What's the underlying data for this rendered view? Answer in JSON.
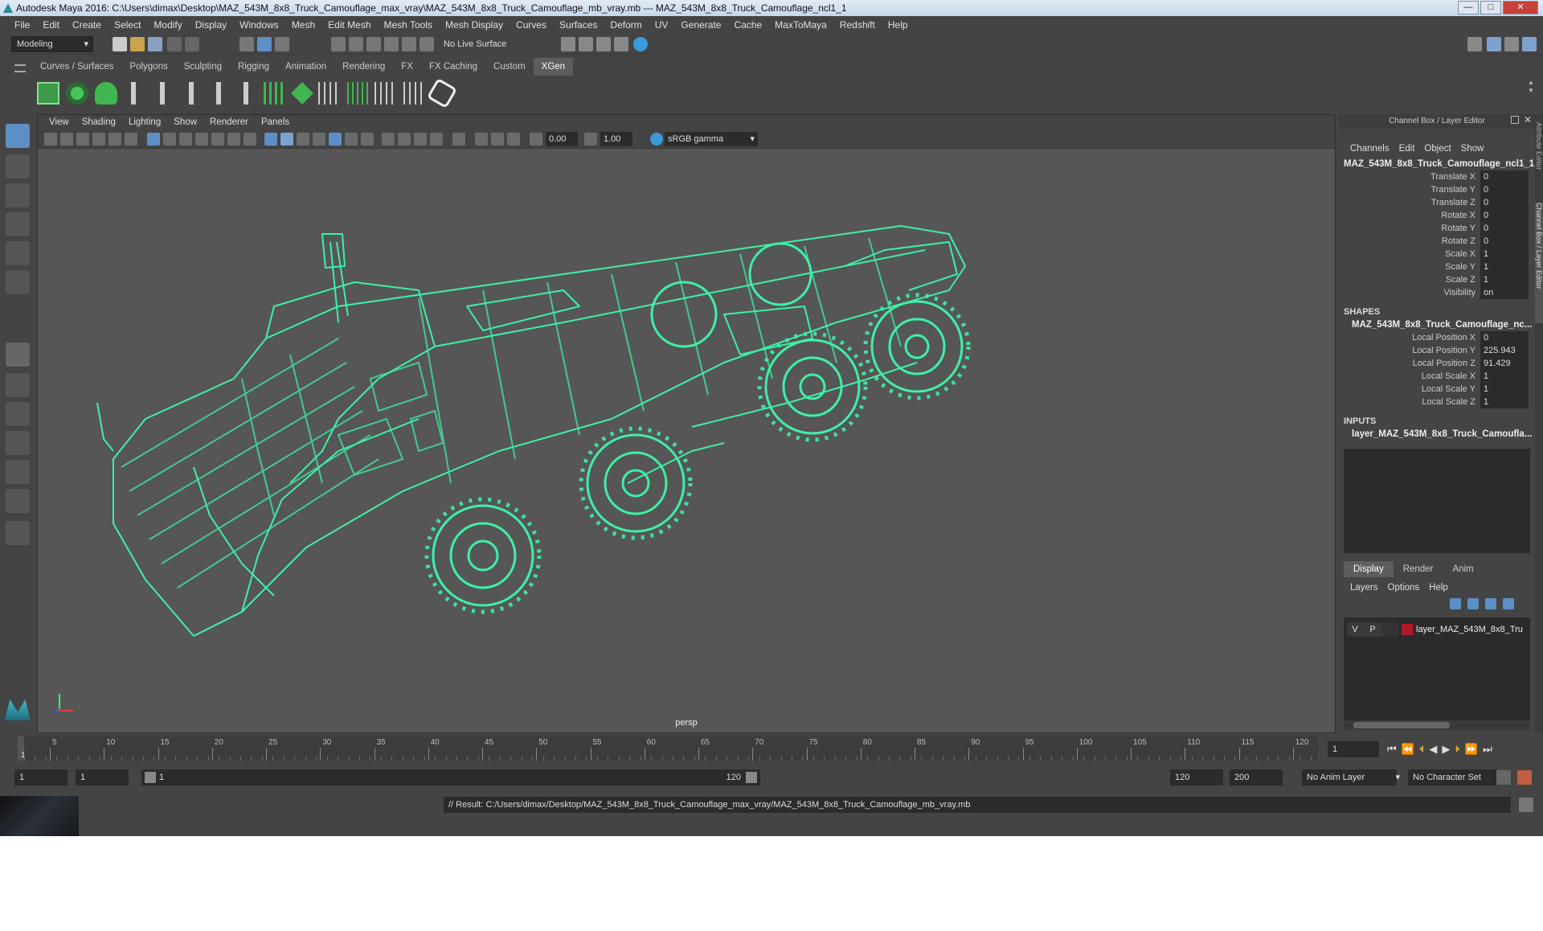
{
  "window": {
    "title": "Autodesk Maya 2016: C:\\Users\\dimax\\Desktop\\MAZ_543M_8x8_Truck_Camouflage_max_vray\\MAZ_543M_8x8_Truck_Camouflage_mb_vray.mb   ---   MAZ_543M_8x8_Truck_Camouflage_ncl1_1",
    "min": "—",
    "max": "□",
    "close": "✕"
  },
  "menus": [
    "File",
    "Edit",
    "Create",
    "Select",
    "Modify",
    "Display",
    "Windows",
    "Mesh",
    "Edit Mesh",
    "Mesh Tools",
    "Mesh Display",
    "Curves",
    "Surfaces",
    "Deform",
    "UV",
    "Generate",
    "Cache",
    "MaxToMaya",
    "Redshift",
    "Help"
  ],
  "status": {
    "mode": "Modeling",
    "live_surface": "No Live Surface"
  },
  "shelf_tabs": [
    "Curves / Surfaces",
    "Polygons",
    "Sculpting",
    "Rigging",
    "Animation",
    "Rendering",
    "FX",
    "FX Caching",
    "Custom",
    "XGen"
  ],
  "shelf_active": "XGen",
  "viewport": {
    "menus": [
      "View",
      "Shading",
      "Lighting",
      "Show",
      "Renderer",
      "Panels"
    ],
    "exposure": "0.00",
    "gamma": "1.00",
    "color_space": "sRGB gamma",
    "camera": "persp"
  },
  "channel_box": {
    "header": "Channel Box / Layer Editor",
    "menus": [
      "Channels",
      "Edit",
      "Object",
      "Show"
    ],
    "object": "MAZ_543M_8x8_Truck_Camouflage_ncl1_1",
    "attributes": [
      {
        "label": "Translate X",
        "value": "0"
      },
      {
        "label": "Translate Y",
        "value": "0"
      },
      {
        "label": "Translate Z",
        "value": "0"
      },
      {
        "label": "Rotate X",
        "value": "0"
      },
      {
        "label": "Rotate Y",
        "value": "0"
      },
      {
        "label": "Rotate Z",
        "value": "0"
      },
      {
        "label": "Scale X",
        "value": "1"
      },
      {
        "label": "Scale Y",
        "value": "1"
      },
      {
        "label": "Scale Z",
        "value": "1"
      },
      {
        "label": "Visibility",
        "value": "on"
      }
    ],
    "shapes_label": "SHAPES",
    "shape_name": "MAZ_543M_8x8_Truck_Camouflage_nc...",
    "shape_attributes": [
      {
        "label": "Local Position X",
        "value": "0"
      },
      {
        "label": "Local Position Y",
        "value": "225.943"
      },
      {
        "label": "Local Position Z",
        "value": "91.429"
      },
      {
        "label": "Local Scale X",
        "value": "1"
      },
      {
        "label": "Local Scale Y",
        "value": "1"
      },
      {
        "label": "Local Scale Z",
        "value": "1"
      }
    ],
    "inputs_label": "INPUTS",
    "input_name": "layer_MAZ_543M_8x8_Truck_Camoufla...",
    "layer_tabs": [
      "Display",
      "Render",
      "Anim"
    ],
    "layer_menus": [
      "Layers",
      "Options",
      "Help"
    ],
    "layer": {
      "v": "V",
      "p": "P",
      "name": "layer_MAZ_543M_8x8_Tru",
      "color": "#b0182a"
    }
  },
  "side_tabs": [
    "Attribute Editor",
    "Channel Box / Layer Editor"
  ],
  "timeline": {
    "ticks": [
      "5",
      "10",
      "15",
      "20",
      "25",
      "30",
      "35",
      "40",
      "45",
      "50",
      "55",
      "60",
      "65",
      "70",
      "75",
      "80",
      "85",
      "90",
      "95",
      "100",
      "105",
      "110",
      "115",
      "120"
    ],
    "start_label": "1",
    "current_frame": "1"
  },
  "range": {
    "start": "1",
    "playback_start": "1",
    "slider_start": "1",
    "slider_end": "120",
    "end": "120",
    "max": "200",
    "anim_layer": "No Anim Layer",
    "char_set": "No Character Set"
  },
  "result": "// Result: C:/Users/dimax/Desktop/MAZ_543M_8x8_Truck_Camouflage_max_vray/MAZ_543M_8x8_Truck_Camouflage_mb_vray.mb",
  "colors": {
    "wire": "#3ef0a6",
    "accent": "#5d8fc7"
  }
}
